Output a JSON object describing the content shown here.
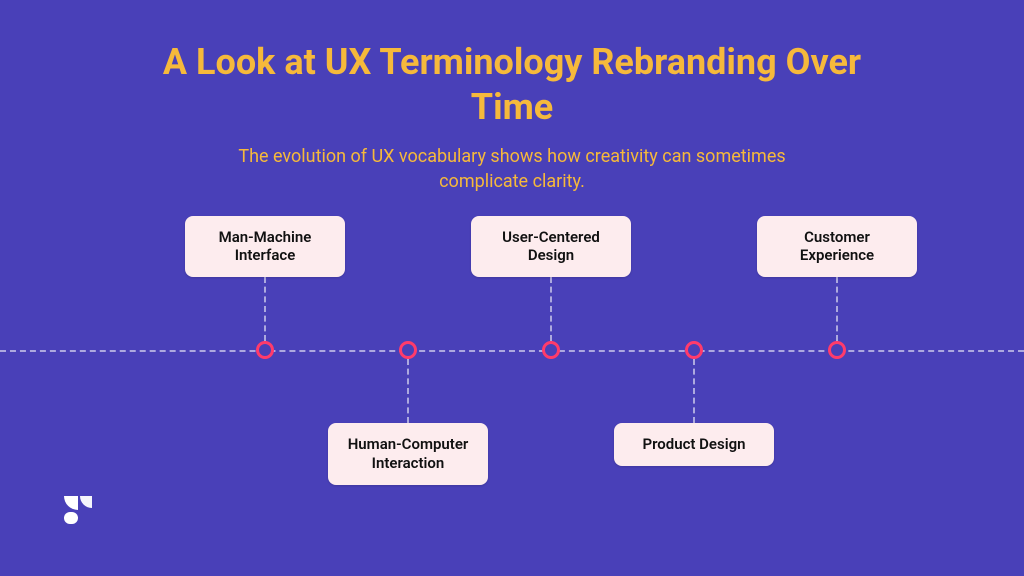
{
  "title": "A Look at UX Terminology Rebranding Over Time",
  "subtitle": "The evolution of UX vocabulary shows how creativity can sometimes complicate clarity.",
  "timeline": {
    "items": [
      {
        "label": "Man-Machine Interface",
        "position": "up"
      },
      {
        "label": "Human-Computer Interaction",
        "position": "down"
      },
      {
        "label": "User-Centered Design",
        "position": "up"
      },
      {
        "label": "Product Design",
        "position": "down"
      },
      {
        "label": "Customer Experience",
        "position": "up"
      }
    ]
  },
  "colors": {
    "background": "#4940B8",
    "accent_text": "#F6B93B",
    "node_ring": "#FF3B6B",
    "card_bg": "#FDECEE"
  }
}
